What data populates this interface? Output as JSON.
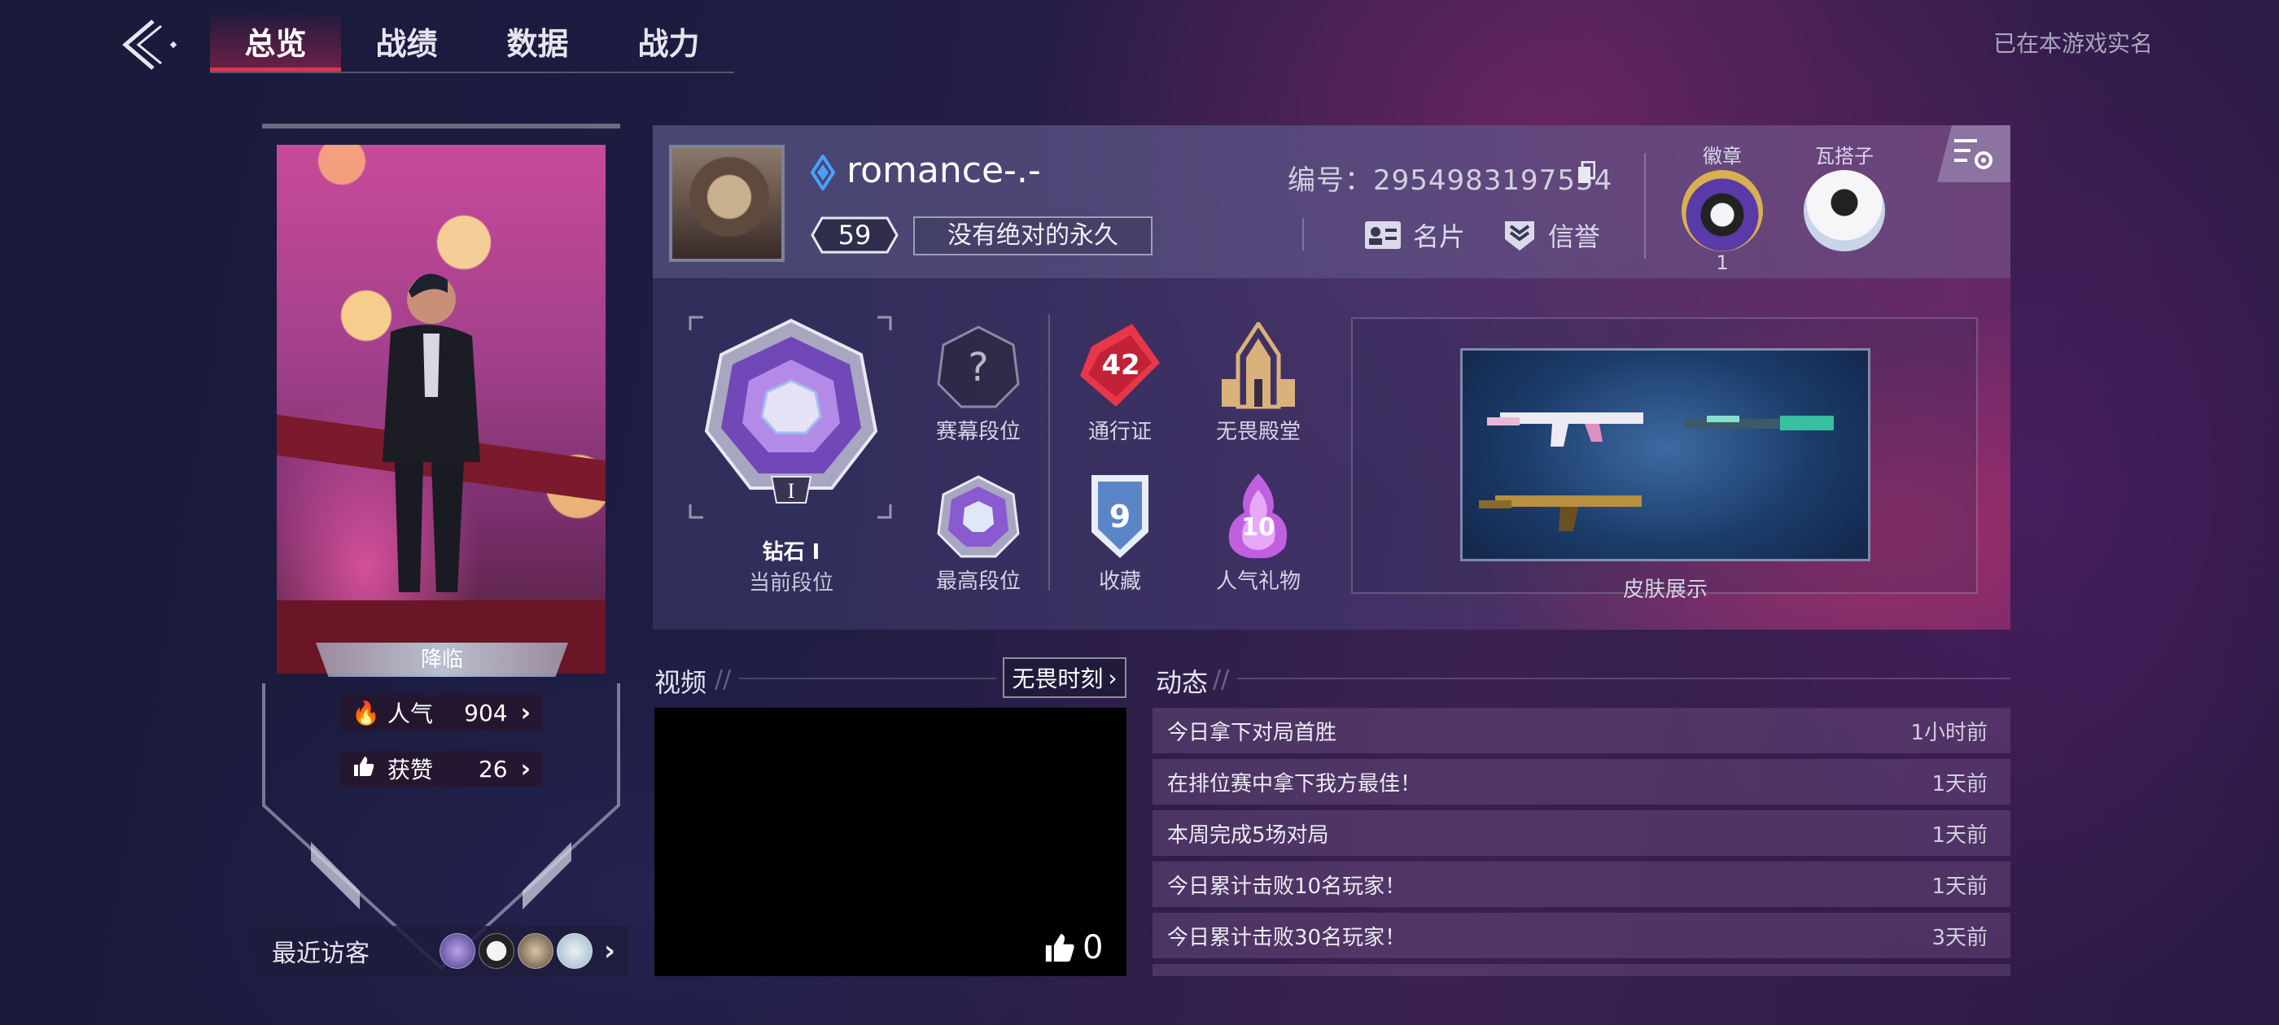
{
  "nav": {
    "back_label": "",
    "tabs": [
      "总览",
      "战绩",
      "数据",
      "战力"
    ],
    "active_tab": 0,
    "realname_status": "已在本游戏实名"
  },
  "player_card": {
    "title": "降临",
    "popularity_label": "人气",
    "popularity_value": "904",
    "likes_label": "获赞",
    "likes_value": "26",
    "visitors_label": "最近访客"
  },
  "profile": {
    "username": "romance-.-",
    "level": "59",
    "motto": "没有绝对的永久",
    "id_label": "编号：2954983197554",
    "namecard_label": "名片",
    "credit_label": "信誉",
    "badge_label": "徽章",
    "badge_count": "1",
    "companion_label": "瓦搭子"
  },
  "ranks": {
    "current_rank": "钻石 I",
    "current_rank_label": "当前段位",
    "current_rank_numeral": "I",
    "season_rank_label": "赛幕段位",
    "peak_rank_label": "最高段位",
    "pass_label": "通行证",
    "pass_value": "42",
    "hall_label": "无畏殿堂",
    "collection_label": "收藏",
    "collection_value": "9",
    "gift_label": "人气礼物",
    "gift_value": "10",
    "skin_label": "皮肤展示"
  },
  "videos": {
    "title": "视频",
    "moments_button": "无畏时刻",
    "like_count": "0"
  },
  "activity": {
    "title": "动态",
    "items": [
      {
        "text": "今日拿下对局首胜",
        "time": "1小时前"
      },
      {
        "text": "在排位赛中拿下我方最佳！",
        "time": "1天前"
      },
      {
        "text": "本周完成5场对局",
        "time": "1天前"
      },
      {
        "text": "今日累计击败10名玩家！",
        "time": "1天前"
      },
      {
        "text": "今日累计击败30名玩家！",
        "time": "3天前"
      }
    ]
  },
  "colors": {
    "accent_red": "#e0334f",
    "rank_purple": "#9a6ae0",
    "pass_red": "#e8364a",
    "hall_gold": "#d8b27a",
    "collection_blue": "#5a86c8"
  }
}
